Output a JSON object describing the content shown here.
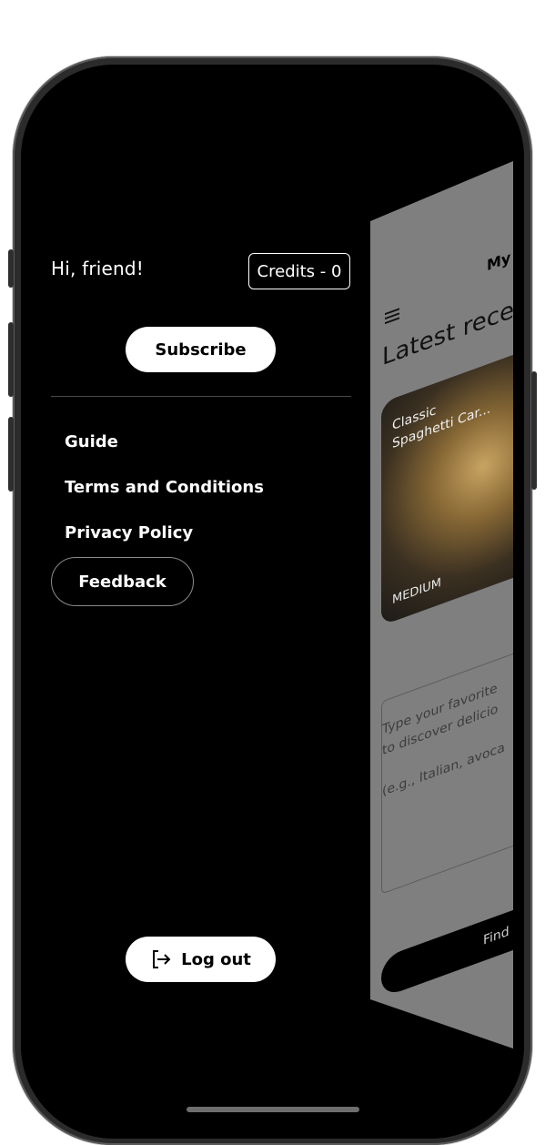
{
  "drawer": {
    "greeting": "Hi, friend!",
    "credits_label": "Credits - 0",
    "subscribe_label": "Subscribe",
    "menu_items": [
      "Guide",
      "Terms and Conditions",
      "Privacy Policy"
    ],
    "feedback_label": "Feedback",
    "logout_label": "Log out",
    "logout_icon": "logout-icon"
  },
  "background_app": {
    "title": "My",
    "heading": "Latest recei",
    "recipe_card": {
      "name_line1": "Classic",
      "name_line2": "Spaghetti Car...",
      "difficulty": "MEDIUM"
    },
    "input_placeholder_line1": "Type your favorite",
    "input_placeholder_line2": "to discover delicio",
    "input_placeholder_line3": "(e.g., Italian, avoca",
    "find_button_label": "Find"
  },
  "colors": {
    "screen_bg": "#000000",
    "button_bg": "#ffffff",
    "peek_card_bg": "#7f7f7f",
    "divider": "#4a4a4a"
  }
}
